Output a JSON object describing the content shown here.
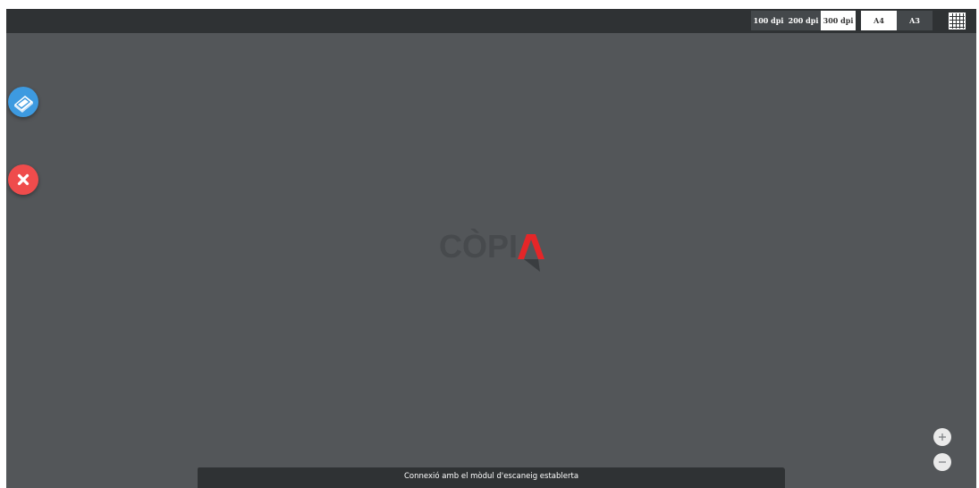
{
  "toolbar": {
    "resolution_options": [
      "100 dpi",
      "200 dpi",
      "300 dpi"
    ],
    "selected_resolution": "300 dpi",
    "paper_sizes": [
      "A4",
      "A3"
    ],
    "selected_paper_size": "A4",
    "grid_icon": "grid-icon"
  },
  "sidebar": {
    "scan_icon": "scanner-icon",
    "close_icon": "close-icon"
  },
  "watermark": {
    "logo_text": "CÒPI",
    "logo_mark": "red-a-mark"
  },
  "zoom": {
    "in_symbol": "+",
    "out_symbol": "−"
  },
  "status": {
    "message": "Connexió amb el mòdul d'escaneig establerta"
  },
  "colors": {
    "canvas_background": "#535659",
    "toolbar_background": "#2f3234",
    "scan_button": "#3d9ae0",
    "close_button": "#ef4c4c",
    "logo_red": "#e52628"
  }
}
